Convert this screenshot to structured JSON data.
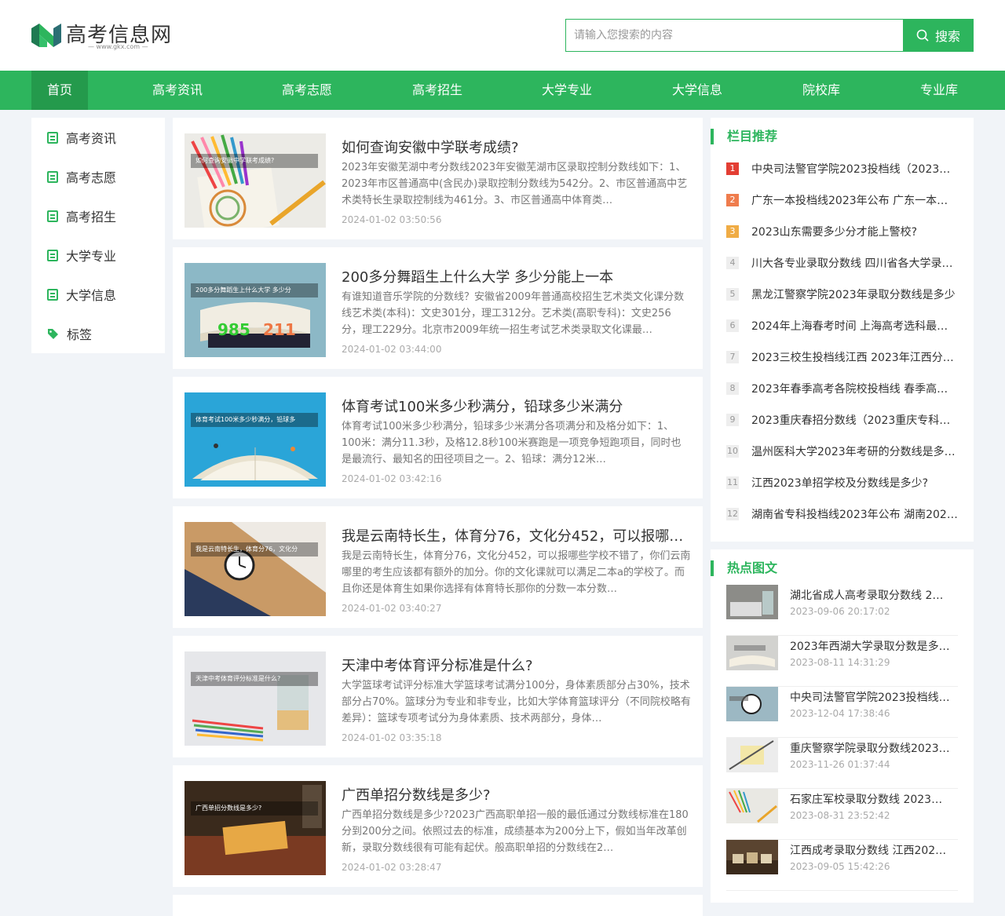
{
  "site": {
    "title": "高考信息网",
    "subtitle": "— www.gkx.com —",
    "brand_color": "#2db55d"
  },
  "search": {
    "placeholder": "请输入您搜索的内容",
    "button": "搜索",
    "icon": "search-icon"
  },
  "nav": {
    "items": [
      {
        "label": "首页",
        "active": true
      },
      {
        "label": "高考资讯"
      },
      {
        "label": "高考志愿"
      },
      {
        "label": "高考招生"
      },
      {
        "label": "大学专业"
      },
      {
        "label": "大学信息"
      },
      {
        "label": "院校库"
      },
      {
        "label": "专业库"
      }
    ]
  },
  "sidebar": {
    "items": [
      {
        "label": "高考资讯",
        "icon": "document-icon"
      },
      {
        "label": "高考志愿",
        "icon": "document-icon"
      },
      {
        "label": "高考招生",
        "icon": "document-icon"
      },
      {
        "label": "大学专业",
        "icon": "document-icon"
      },
      {
        "label": "大学信息",
        "icon": "document-icon"
      },
      {
        "label": "标签",
        "icon": "tag-icon"
      }
    ]
  },
  "articles": [
    {
      "thumb_caption": "如何查询安徽中学联考成绩?",
      "title": "如何查询安徽中学联考成绩?",
      "desc": "2023年安徽芜湖中考分数线2023年安徽芜湖市区录取控制分数线如下：1、2023年市区普通高中(含民办)录取控制分数线为542分。2、市区普通高中艺术类特长生录取控制线为461分。3、市区普通高中体育类…",
      "date": "2024-01-02 03:50:56"
    },
    {
      "thumb_caption": "200多分舞蹈生上什么大学 多少分",
      "title": "200多分舞蹈生上什么大学 多少分能上一本",
      "desc": "有谁知道音乐学院的分数线？安徽省2009年普通高校招生艺术类文化课分数线艺术类(本科)：文史301分，理工312分。艺术类(高职专科)：文史256分，理工229分。北京市2009年统一招生考试艺术类录取文化课最…",
      "date": "2024-01-02 03:44:00"
    },
    {
      "thumb_caption": "体育考试100米多少秒满分，铅球多",
      "title": "体育考试100米多少秒满分，铅球多少米满分",
      "desc": "体育考试100米多少秒满分，铅球多少米满分各项满分和及格分如下：1、100米：满分11.3秒，及格12.8秒100米赛跑是一项竞争短跑项目，同时也是最流行、最知名的田径项目之一。2、铅球：满分12米…",
      "date": "2024-01-02 03:42:16"
    },
    {
      "thumb_caption": "我是云南特长生，体育分76，文化分",
      "title": "我是云南特长生，体育分76，文化分452，可以报哪些学校?",
      "desc": "我是云南特长生，体育分76，文化分452，可以报哪些学校不错了，你们云南哪里的考生应该都有额外的加分。你的文化课就可以满足二本a的学校了。而且你还是体育生如果你选择有体育特长那你的分数一本分数…",
      "date": "2024-01-02 03:40:27"
    },
    {
      "thumb_caption": "天津中考体育评分标准是什么?",
      "title": "天津中考体育评分标准是什么?",
      "desc": "大学篮球考试评分标准大学篮球考试满分100分，身体素质部分占30%，技术部分占70%。篮球分为专业和非专业，比如大学体育篮球评分（不同院校略有差异）：篮球专项考试分为身体素质、技术两部分，身体…",
      "date": "2024-01-02 03:35:18"
    },
    {
      "thumb_caption": "广西单招分数线是多少?",
      "title": "广西单招分数线是多少?",
      "desc": "广西单招分数线是多少?2023广西高职单招一般的最低通过分数线标准在180分到200分之间。依照过去的标准，成绩基本为200分上下，假如当年改革创新，录取分数线很有可能有起伏。般高职单招的分数线在2…",
      "date": "2024-01-02 03:28:47"
    }
  ],
  "recommend": {
    "title": "栏目推荐",
    "items": [
      {
        "num": "1",
        "text": "中央司法警官学院2023投档线（2023年…"
      },
      {
        "num": "2",
        "text": "广东一本投档线2023年公布 广东一本线…"
      },
      {
        "num": "3",
        "text": "2023山东需要多少分才能上警校?"
      },
      {
        "num": "4",
        "text": "川大各专业录取分数线 四川省各大学录…"
      },
      {
        "num": "5",
        "text": "黑龙江警察学院2023年录取分数线是多少"
      },
      {
        "num": "6",
        "text": "2024年上海春考时间 上海高考选科最新…"
      },
      {
        "num": "7",
        "text": "2023三校生投档线江西 2023年江西分数…"
      },
      {
        "num": "8",
        "text": "2023年春季高考各院校投档线 春季高考…"
      },
      {
        "num": "9",
        "text": "2023重庆春招分数线（2023重庆专科学…"
      },
      {
        "num": "10",
        "text": "温州医科大学2023年考研的分数线是多…"
      },
      {
        "num": "11",
        "text": "江西2023单招学校及分数线是多少?"
      },
      {
        "num": "12",
        "text": "湖南省专科投档线2023年公布 湖南2023…"
      }
    ]
  },
  "hot": {
    "title": "热点图文",
    "items": [
      {
        "title": "湖北省成人高考录取分数线 2…",
        "date": "2023-09-06 20:17:02"
      },
      {
        "title": "2023年西湖大学录取分数是多…",
        "date": "2023-08-11 14:31:29"
      },
      {
        "title": "中央司法警官学院2023投档线…",
        "date": "2023-12-04 17:38:46"
      },
      {
        "title": "重庆警察学院录取分数线2023…",
        "date": "2023-11-26 01:37:44"
      },
      {
        "title": "石家庄军校录取分数线 2023…",
        "date": "2023-08-31 23:52:42"
      },
      {
        "title": "江西成考录取分数线 江西202…",
        "date": "2023-09-05 15:42:26"
      }
    ]
  }
}
